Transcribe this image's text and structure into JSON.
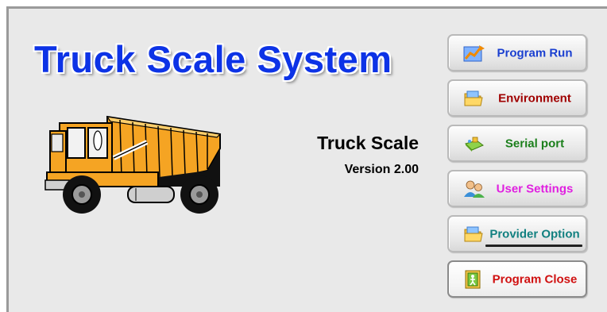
{
  "app": {
    "title": "Truck Scale System",
    "product_name": "Truck Scale",
    "version": "Version 2.00"
  },
  "menu": {
    "program_run": {
      "label": "Program Run",
      "color": "#1a3fd0",
      "icon": "chart-icon"
    },
    "environment": {
      "label": "Environment",
      "color": "#a00000",
      "icon": "folder-icon"
    },
    "serial_port": {
      "label": "Serial port",
      "color": "#1b7f1b",
      "icon": "serial-port-icon"
    },
    "user_settings": {
      "label": "User Settings",
      "color": "#e020e0",
      "icon": "users-icon"
    },
    "provider": {
      "label": "Provider Option",
      "color": "#128080",
      "icon": "folder-icon"
    },
    "program_close": {
      "label": "Program Close",
      "color": "#d01010",
      "icon": "exit-door-icon"
    }
  },
  "colors": {
    "title_blue": "#0d33e6",
    "background": "#e9e9e9",
    "truck_orange": "#f5a423"
  }
}
